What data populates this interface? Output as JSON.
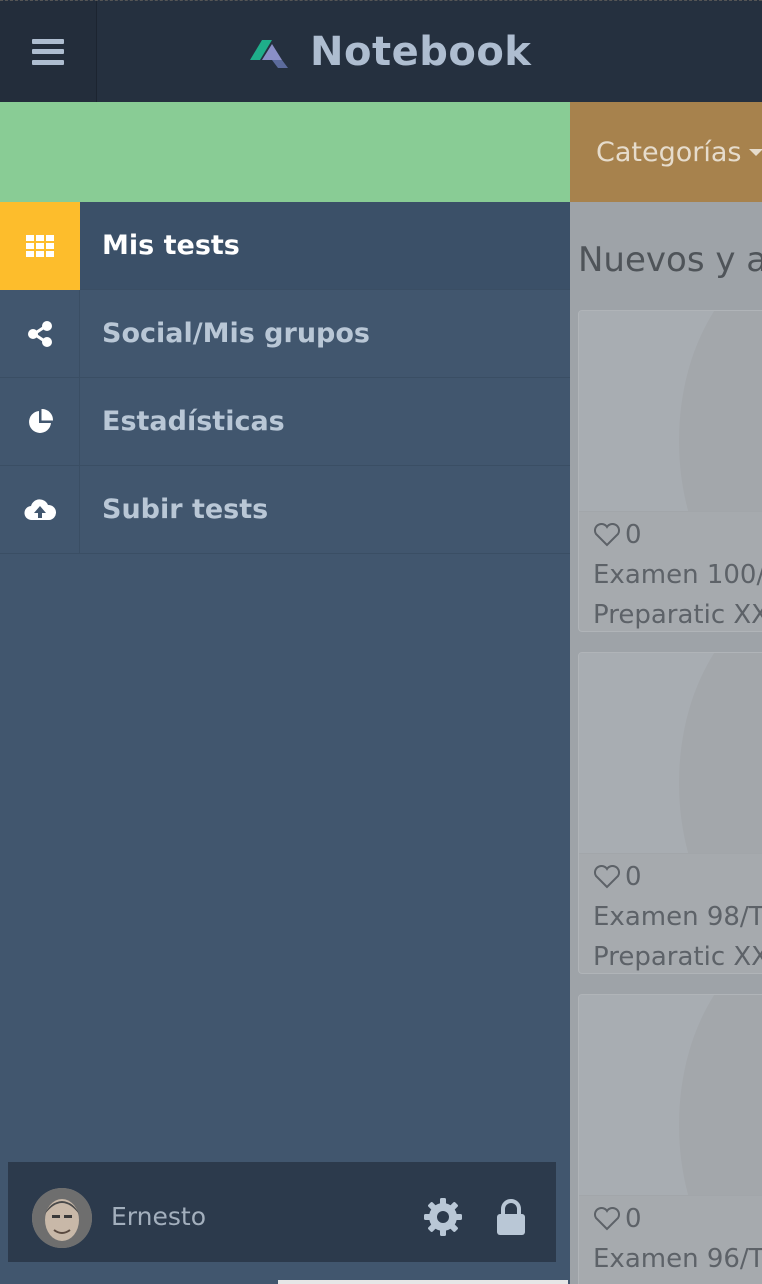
{
  "header": {
    "brand": "Notebook"
  },
  "categories": {
    "label": "Categorías"
  },
  "sidebar": {
    "items": [
      {
        "label": "Mis tests",
        "icon": "grid-icon",
        "active": true
      },
      {
        "label": "Social/Mis grupos",
        "icon": "share-icon",
        "active": false
      },
      {
        "label": "Estadísticas",
        "icon": "pie-chart-icon",
        "active": false
      },
      {
        "label": "Subir tests",
        "icon": "cloud-upload-icon",
        "active": false
      }
    ]
  },
  "user": {
    "name": "Ernesto"
  },
  "main": {
    "section_title": "Nuevos y a",
    "cards": [
      {
        "likes": "0",
        "title": "Examen 100/",
        "subtitle": "Preparatic XX"
      },
      {
        "likes": "0",
        "title": "Examen 98/T",
        "subtitle": "Preparatic XX"
      },
      {
        "likes": "0",
        "title": "Examen 96/T",
        "subtitle": ""
      }
    ]
  },
  "colors": {
    "topbar": "#25303f",
    "sidebar": "#41566e",
    "active_accent": "#fdbd2c",
    "green_band": "#89cc95",
    "categories_bg": "#a7824d"
  }
}
